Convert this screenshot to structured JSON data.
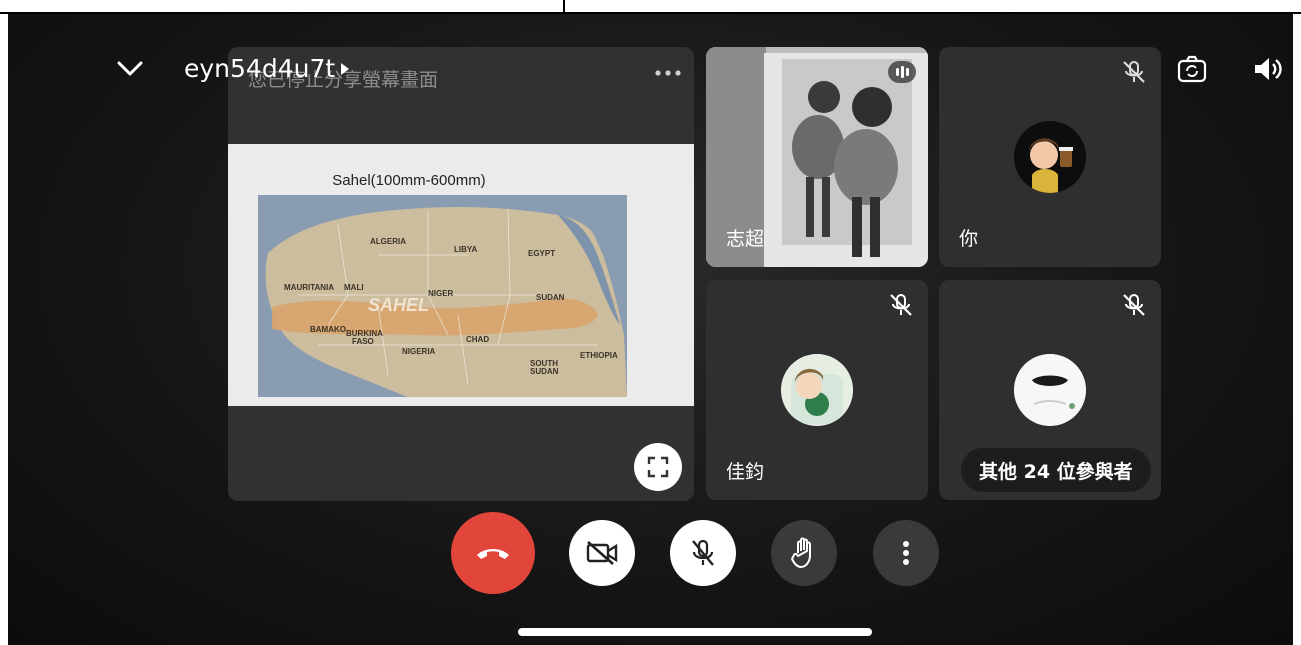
{
  "meeting": {
    "code": "eyn54d4u7t",
    "share_caption": "您已停止分享螢幕畫面"
  },
  "slide": {
    "title": "Sahel(100mm-600mm)",
    "map_labels": {
      "algeria": "ALGERIA",
      "libya": "LIBYA",
      "egypt": "EGYPT",
      "mauritania": "MAURITANIA",
      "mali": "MALI",
      "niger": "NIGER",
      "sudan": "SUDAN",
      "sahel": "SAHEL",
      "bamako": "BAMAKO",
      "burkina": "BURKINA",
      "faso": "FASO",
      "chad": "CHAD",
      "nigeria": "NIGERIA",
      "south": "SOUTH",
      "south_sudan": "SUDAN",
      "ethiopia": "ETHIOPIA"
    }
  },
  "participants": {
    "p1_name": "志超",
    "p2_name": "你",
    "p3_name": "佳鈞",
    "overflow_label": "其他 24 位參與者"
  },
  "colors": {
    "end_call": "#e2463a",
    "tile_bg": "#2f2f30",
    "sahel_band": "#d9a36b"
  },
  "icons": {
    "collapse": "chevron-down-icon",
    "switch_camera": "camera-switch-icon",
    "speaker": "volume-icon",
    "end_call": "phone-hangup-icon",
    "camera_off": "video-off-icon",
    "mic_off": "mic-off-icon",
    "raise_hand": "hand-icon",
    "more": "more-vertical-icon"
  }
}
